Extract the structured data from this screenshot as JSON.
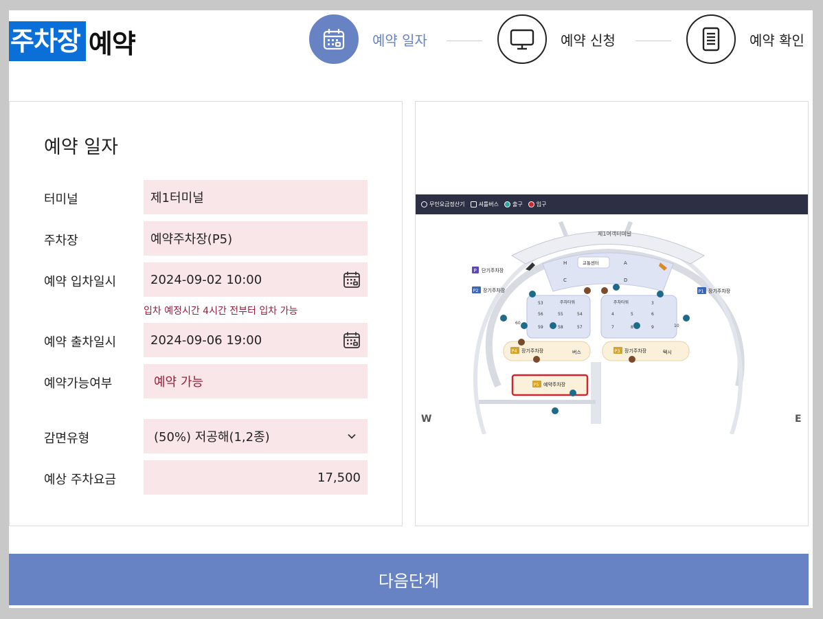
{
  "header": {
    "title_highlight": "주차장",
    "title_rest": "예약"
  },
  "steps": [
    {
      "label": "예약 일자",
      "icon": "calendar-icon",
      "active": true
    },
    {
      "label": "예약 신청",
      "icon": "monitor-icon",
      "active": false
    },
    {
      "label": "예약 확인",
      "icon": "document-icon",
      "active": false
    }
  ],
  "form": {
    "title": "예약 일자",
    "terminal_label": "터미널",
    "terminal_value": "제1터미널",
    "parking_label": "주차장",
    "parking_value": "예약주차장(P5)",
    "entry_label": "예약 입차일시",
    "entry_value": "2024-09-02 10:00",
    "entry_hint": "입차 예정시간 4시간 전부터 입차 가능",
    "exit_label": "예약 출차일시",
    "exit_value": "2024-09-06 19:00",
    "availability_label": "예약가능여부",
    "availability_value": "예약 가능",
    "discount_label": "감면유형",
    "discount_value": "(50%) 저공해(1,2종)",
    "fee_label": "예상 주차요금",
    "fee_value": "17,500"
  },
  "map": {
    "legend": [
      "무인요금정산기",
      "셔틀버스",
      "출구",
      "입구"
    ],
    "terminal_name": "제1여객터미널",
    "traffic_center": "교통센터",
    "short_term": "단기주차장",
    "long_term": "장기주차장",
    "p4_label": "장기주차장",
    "p3_label": "장기주차장",
    "bus": "버스",
    "taxi": "택시",
    "p5_label": "예약주차장",
    "compass_w": "W",
    "compass_e": "E",
    "colors": {
      "highlight": "#d0252f",
      "bar": "#2d3044",
      "zone": "#dfe4f5",
      "lot": "#fbf0d9"
    }
  },
  "next_button": "다음단계",
  "colors": {
    "accent": "#6883c4",
    "title_highlight": "#0a6fd8",
    "field_bg": "#f9e6e8",
    "hint": "#9a1d3c"
  }
}
